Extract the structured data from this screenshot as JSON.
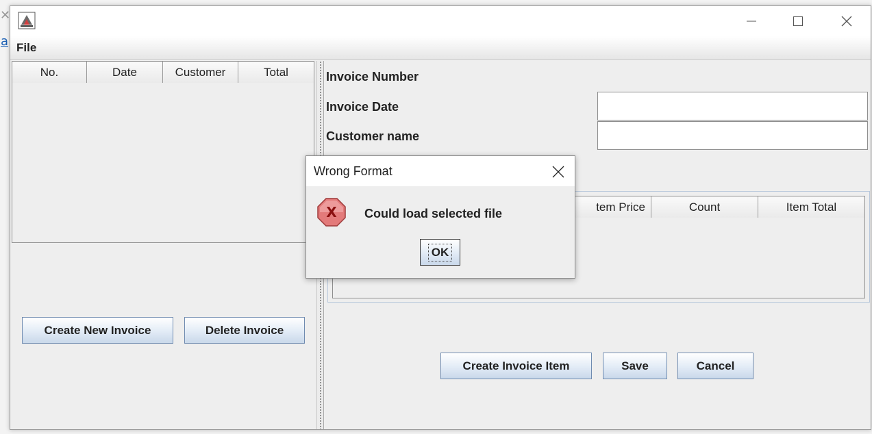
{
  "window": {
    "menu": {
      "file_label": "File"
    }
  },
  "invoices_table": {
    "columns": [
      "No.",
      "Date",
      "Customer",
      "Total"
    ]
  },
  "left_buttons": {
    "create_new_invoice": "Create New Invoice",
    "delete_invoice": "Delete Invoice"
  },
  "invoice_form": {
    "invoice_number_label": "Invoice Number",
    "invoice_date_label": "Invoice Date",
    "customer_name_label": "Customer name",
    "invoice_date_value": "",
    "customer_name_value": ""
  },
  "items_table": {
    "columns": [
      "tem Price",
      "Count",
      "Item Total"
    ]
  },
  "right_buttons": {
    "create_invoice_item": "Create Invoice Item",
    "save": "Save",
    "cancel": "Cancel"
  },
  "dialog": {
    "title": "Wrong Format",
    "message": "Could load selected file",
    "ok_label": "OK",
    "icon": "error-icon"
  },
  "colors": {
    "window_bg": "#eeeeee",
    "button_border": "#6f8bb0",
    "error_icon_red": "#e06b6b"
  }
}
